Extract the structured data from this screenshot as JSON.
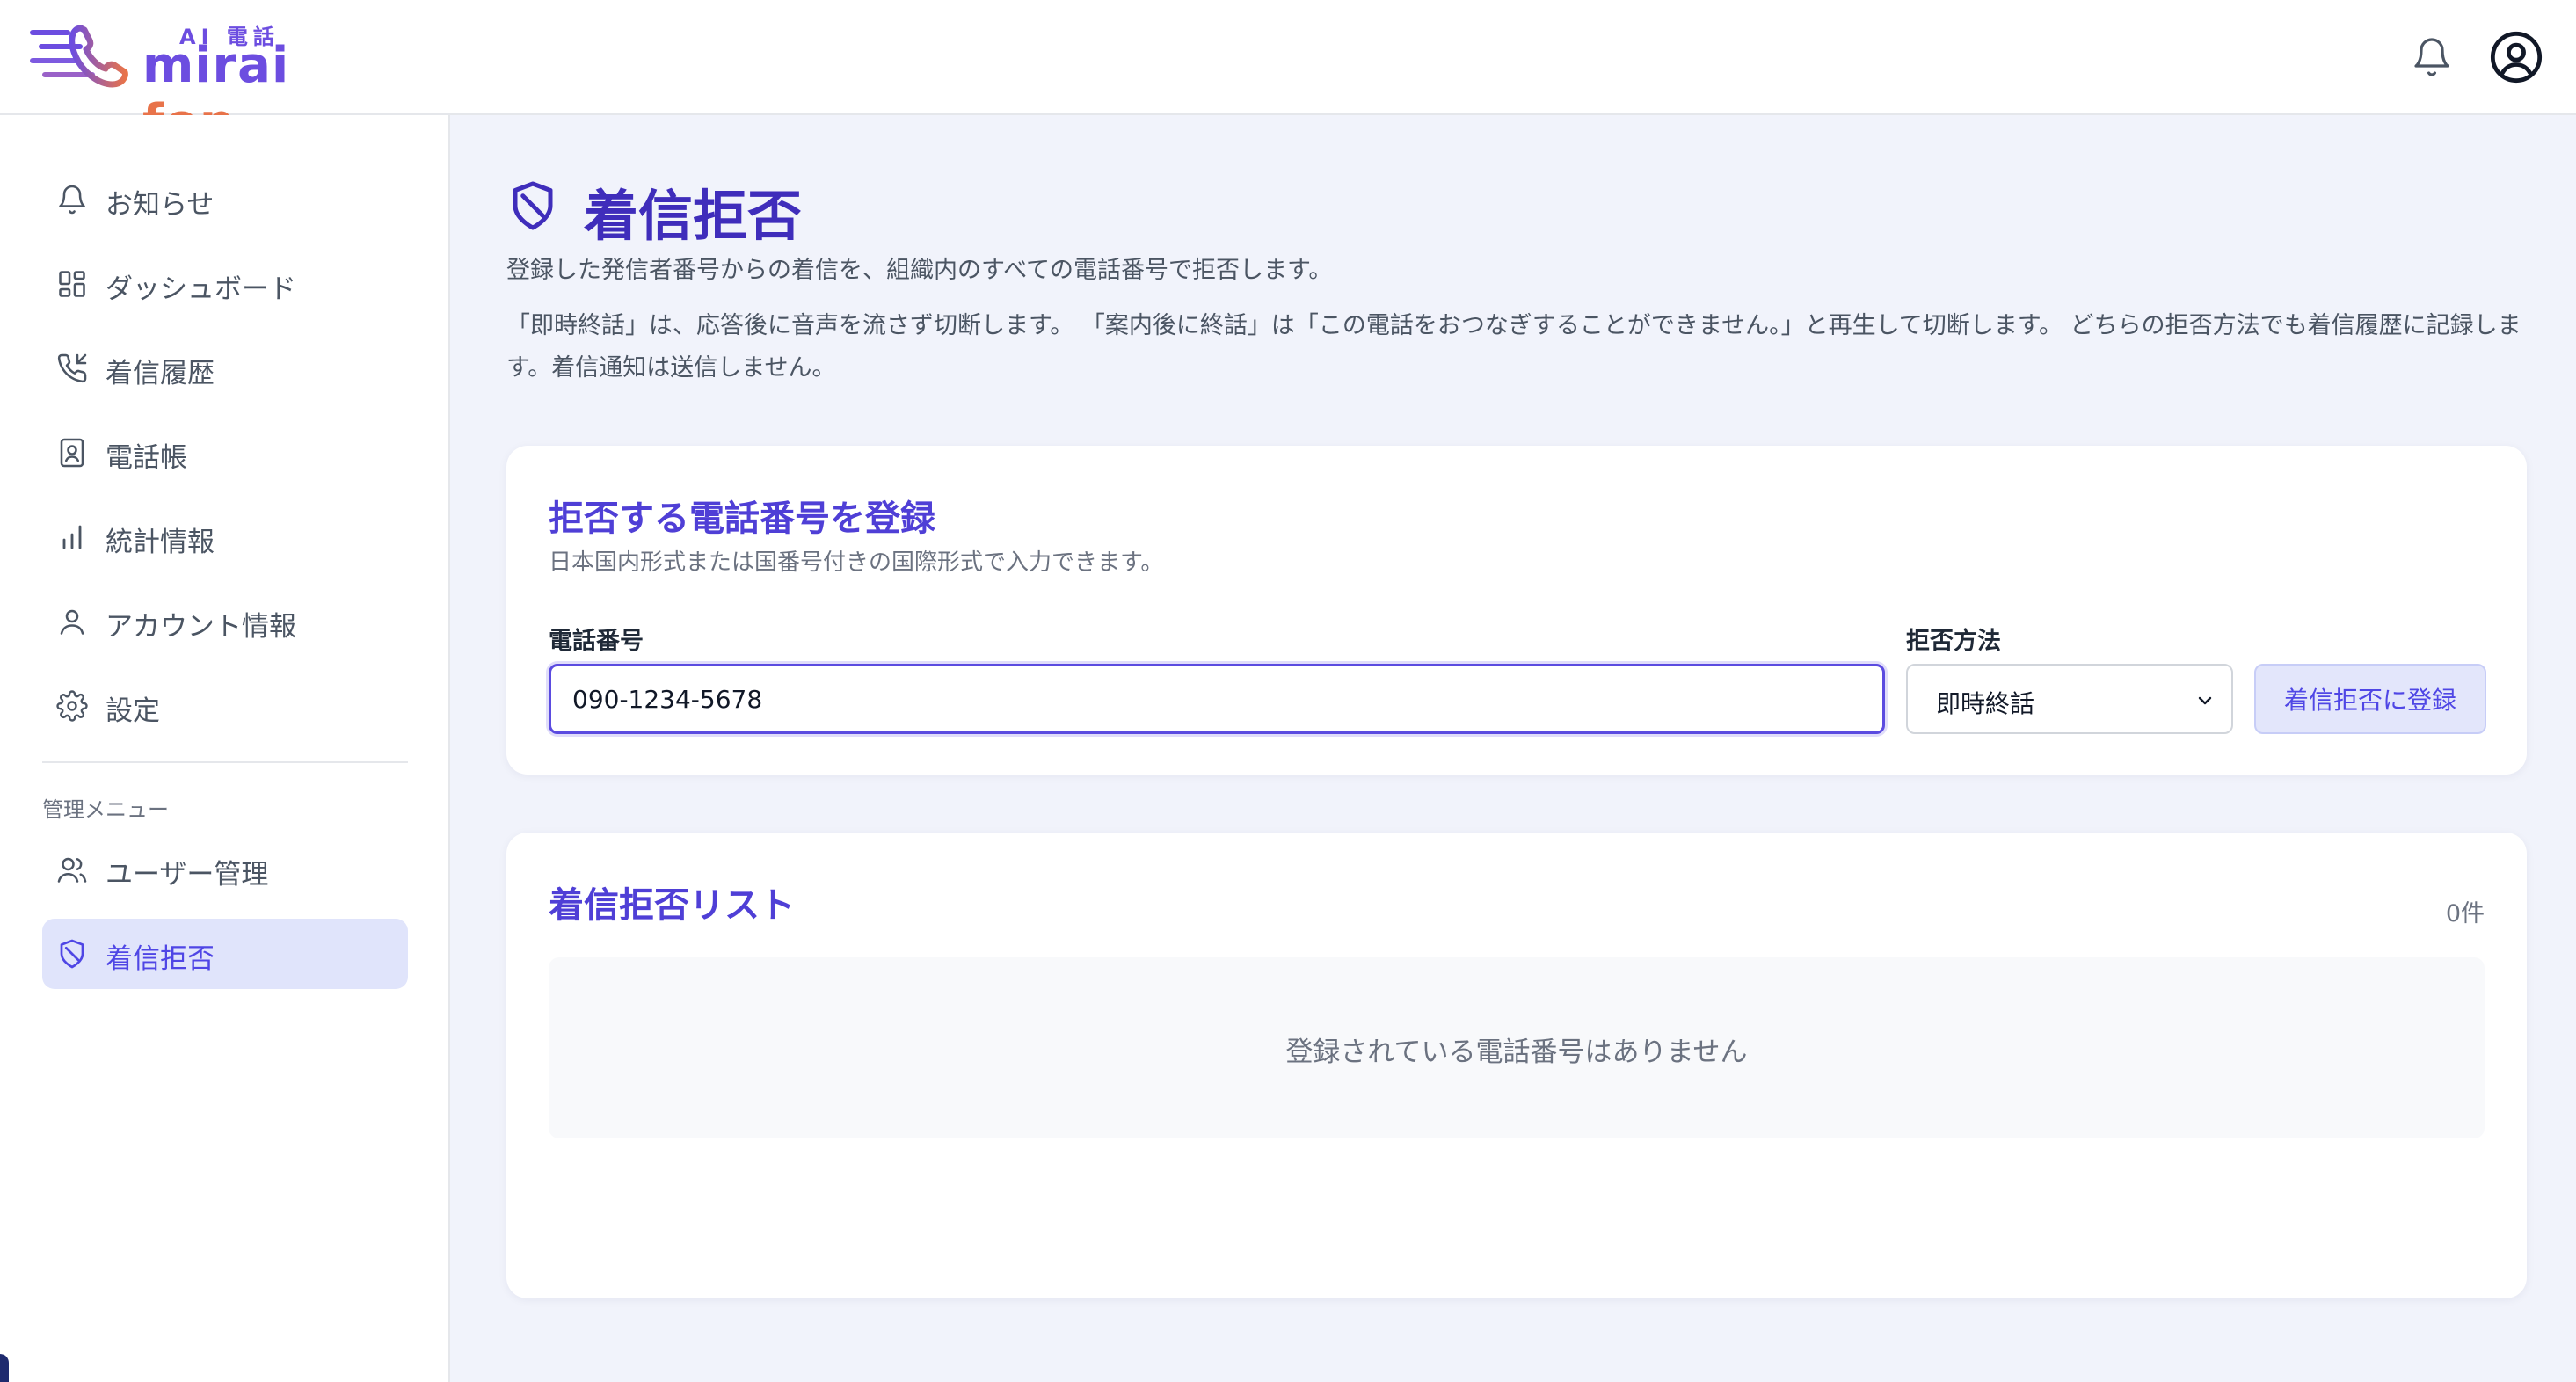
{
  "header": {
    "logo_ai": "AI 電話",
    "logo_name_main": "mirai ",
    "logo_name_accent": "fon",
    "bell_icon": "bell-icon",
    "user_icon": "user-circle-icon"
  },
  "sidebar": {
    "items": [
      {
        "label": "お知らせ",
        "icon": "bell-icon"
      },
      {
        "label": "ダッシュボード",
        "icon": "dashboard-icon"
      },
      {
        "label": "着信履歴",
        "icon": "phone-incoming-icon"
      },
      {
        "label": "電話帳",
        "icon": "contact-book-icon"
      },
      {
        "label": "統計情報",
        "icon": "bar-chart-icon"
      },
      {
        "label": "アカウント情報",
        "icon": "user-icon"
      },
      {
        "label": "設定",
        "icon": "gear-icon"
      }
    ],
    "admin_heading": "管理メニュー",
    "admin_items": [
      {
        "label": "ユーザー管理",
        "icon": "users-icon"
      },
      {
        "label": "着信拒否",
        "icon": "shield-block-icon",
        "active": true
      }
    ]
  },
  "main": {
    "title": "着信拒否",
    "description": "登録した発信者番号からの着信を、組織内のすべての電話番号で拒否します。",
    "note": "「即時終話」は、応答後に音声を流さず切断します。 「案内後に終話」は「この電話をおつなぎすることができません。」と再生して切断します。 どちらの拒否方法でも着信履歴に記録します。着信通知は送信しません。",
    "register": {
      "title": "拒否する電話番号を登録",
      "subtitle": "日本国内形式または国番号付きの国際形式で入力できます。",
      "phone_label": "電話番号",
      "phone_value": "090-1234-5678",
      "method_label": "拒否方法",
      "method_value": "即時終話",
      "submit_label": "着信拒否に登録"
    },
    "list": {
      "title": "着信拒否リスト",
      "count": "0件",
      "empty_message": "登録されている電話番号はありません"
    }
  },
  "colors": {
    "accent": "#4f46e5",
    "title": "#3f2dbb",
    "active_bg": "#e0e4fb",
    "logo_orange": "#e8734a"
  }
}
